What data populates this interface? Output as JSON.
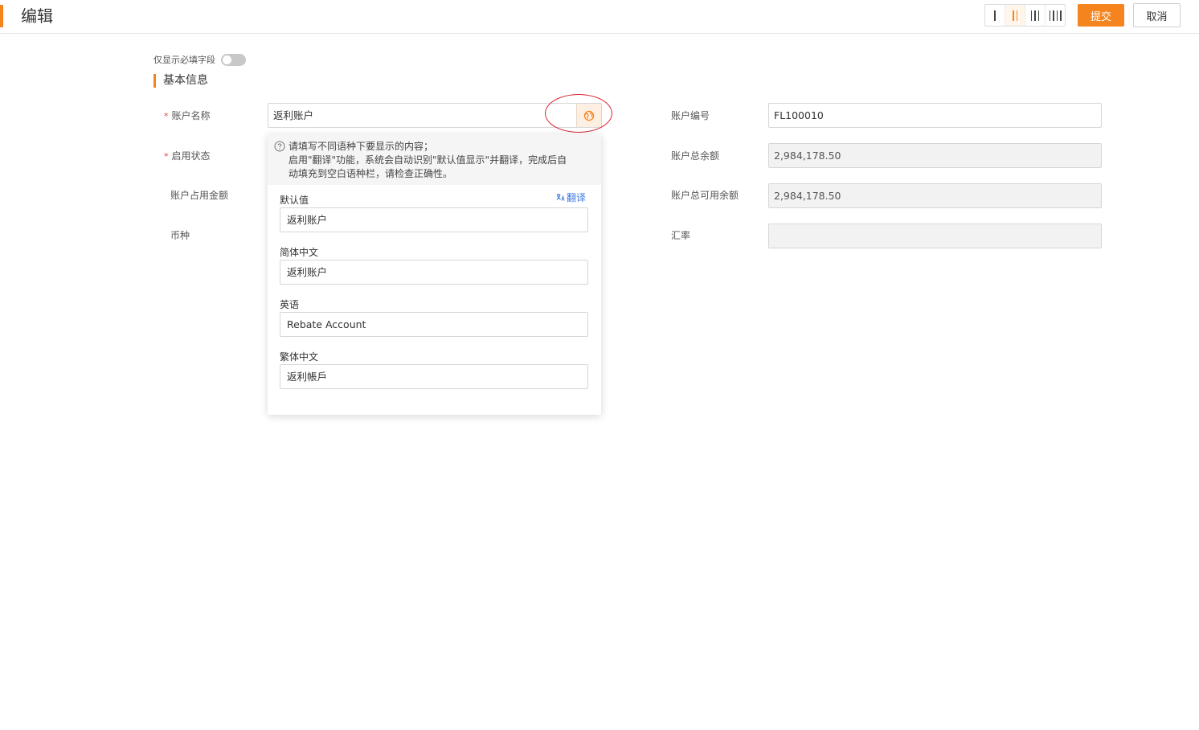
{
  "header": {
    "title": "编辑",
    "submit_label": "提交",
    "cancel_label": "取消",
    "layout_options": [
      "1-column",
      "2-column",
      "3-column",
      "4-column"
    ],
    "active_layout": "2-column"
  },
  "form": {
    "required_only_label": "仅显示必填字段",
    "required_only_on": false,
    "section_title": "基本信息",
    "fields": {
      "account_name": {
        "label": "账户名称",
        "required": true,
        "value": "返利账户"
      },
      "status": {
        "label": "启用状态",
        "required": true
      },
      "occupied_amount": {
        "label": "账户占用金额"
      },
      "currency": {
        "label": "币种"
      },
      "account_code": {
        "label": "账户编号",
        "value": "FL100010"
      },
      "total_balance": {
        "label": "账户总余额",
        "value": "2,984,178.50"
      },
      "available_balance": {
        "label": "账户总可用余额",
        "value": "2,984,178.50"
      },
      "exchange_rate": {
        "label": "汇率",
        "value": ""
      }
    }
  },
  "translation_popup": {
    "tip_line1": "请填写不同语种下要显示的内容；",
    "tip_line2": "启用\"翻译\"功能，系统会自动识别\"默认值显示\"并翻译，完成后自",
    "tip_line3": "动填充到空白语种栏，请检查正确性。",
    "translate_label": "翻译",
    "languages": [
      {
        "label": "默认值",
        "value": "返利账户"
      },
      {
        "label": "简体中文",
        "value": "返利账户"
      },
      {
        "label": "英语",
        "value": "Rebate Account"
      },
      {
        "label": "繁体中文",
        "value": "返利帳戶"
      }
    ]
  },
  "colors": {
    "accent": "#f5841f",
    "link": "#3c77e6",
    "required_star": "#e8453c",
    "annotation_ring": "#d9232d"
  }
}
